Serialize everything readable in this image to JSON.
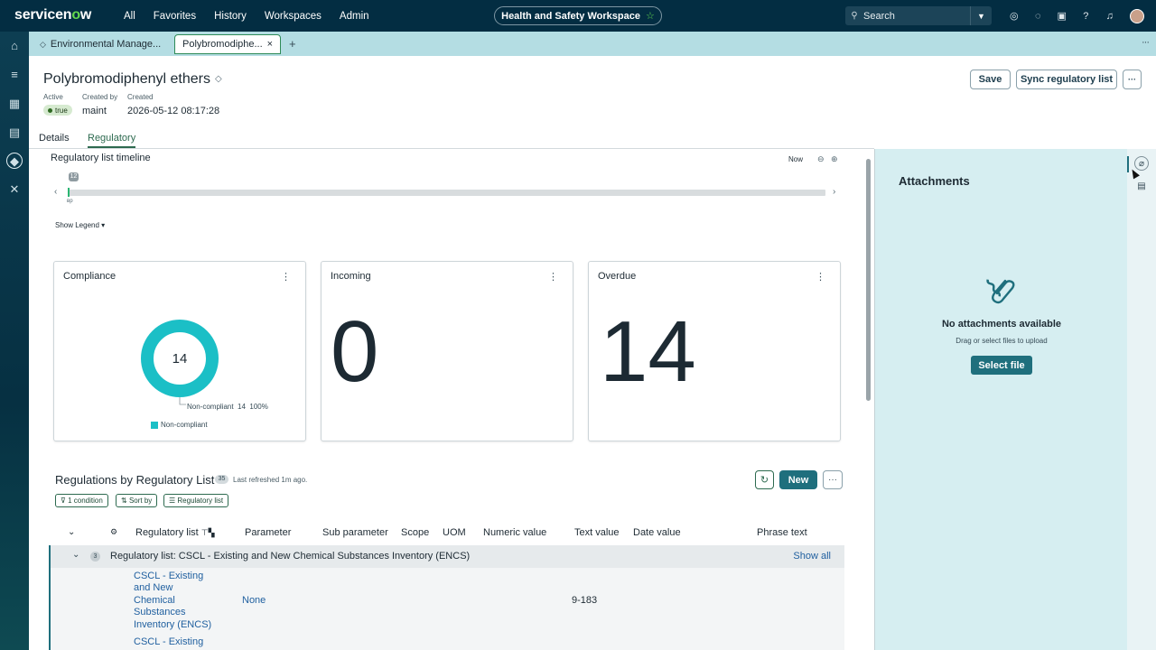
{
  "topnav": {
    "logo": "servicenow",
    "menu": [
      "All",
      "Favorites",
      "History",
      "Workspaces",
      "Admin"
    ],
    "workspace": "Health and Safety Workspace",
    "search_placeholder": "Search"
  },
  "tabs": {
    "inactive_label": "Environmental Manage...",
    "active_label": "Polybromodiphe...",
    "close": "×",
    "add": "+"
  },
  "record": {
    "title": "Polybromodiphenyl ethers",
    "active_label": "Active",
    "active_value": "true",
    "created_by_label": "Created by",
    "created_by_value": "maint",
    "created_label": "Created",
    "created_value": "2026-05-12 08:17:28",
    "save_label": "Save",
    "sync_label": "Sync regulatory list",
    "more_label": "···"
  },
  "record_tabs": [
    "Details",
    "Regulatory"
  ],
  "timeline": {
    "title": "Regulatory list timeline",
    "now_label": "Now",
    "badge": "12",
    "sub": "вр",
    "show_legend": "Show Legend"
  },
  "cards": {
    "compliance": {
      "title": "Compliance",
      "center_value": "14",
      "slice_label": "Non-compliant",
      "slice_count": "14",
      "slice_pct": "100%",
      "legend": "Non-compliant",
      "color": "#1bbfc6"
    },
    "incoming": {
      "title": "Incoming",
      "value": "0"
    },
    "overdue": {
      "title": "Overdue",
      "value": "14"
    }
  },
  "regulations": {
    "title": "Regulations by Regulatory List",
    "count": "35",
    "refreshed": "Last refreshed 1m ago.",
    "new_label": "New",
    "chips": [
      "1 condition",
      "Sort by",
      "Regulatory list"
    ],
    "columns": [
      "Regulatory list",
      "Parameter",
      "Sub parameter",
      "Scope",
      "UOM",
      "Numeric value",
      "Text value",
      "Date value",
      "Phrase text"
    ],
    "group": {
      "count": "3",
      "label": "Regulatory list: CSCL - Existing and New Chemical Substances Inventory (ENCS)",
      "show_all": "Show all"
    },
    "rows": [
      {
        "regulatory_list_lines": [
          "CSCL - Existing",
          "and New",
          "Chemical",
          "Substances",
          "Inventory (ENCS)"
        ],
        "parameter": "None",
        "text_value": "9-183"
      },
      {
        "regulatory_list_lines": [
          "CSCL - Existing"
        ],
        "parameter": "",
        "text_value": ""
      }
    ]
  },
  "attachments": {
    "title": "Attachments",
    "empty": "No attachments available",
    "hint": "Drag or select files to upload",
    "button": "Select file"
  }
}
